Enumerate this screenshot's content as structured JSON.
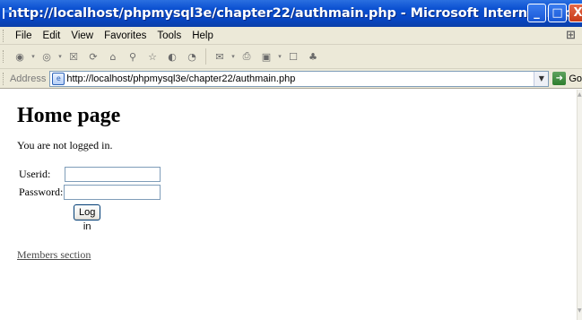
{
  "window": {
    "title": "http://localhost/phpmysql3e/chapter22/authmain.php - Microsoft Internet Explorer",
    "buttons": {
      "minimize": "_",
      "maximize": "□",
      "close": "X"
    }
  },
  "menu": {
    "items": [
      "File",
      "Edit",
      "View",
      "Favorites",
      "Tools",
      "Help"
    ]
  },
  "toolbar": {
    "icons": [
      "back-icon",
      "forward-icon",
      "stop-icon",
      "refresh-icon",
      "home-icon",
      "search-icon",
      "favorites-icon",
      "media-icon",
      "history-icon",
      "mail-icon",
      "print-icon",
      "edit-icon",
      "discuss-icon",
      "messenger-icon"
    ]
  },
  "address": {
    "label": "Address",
    "url": "http://localhost/phpmysql3e/chapter22/authmain.php",
    "go_label": "Go"
  },
  "page": {
    "heading": "Home page",
    "status": "You are not logged in.",
    "form": {
      "userid_label": "Userid:",
      "userid_value": "",
      "password_label": "Password:",
      "password_value": "",
      "submit_label": "Log in"
    },
    "members_link": "Members section"
  }
}
